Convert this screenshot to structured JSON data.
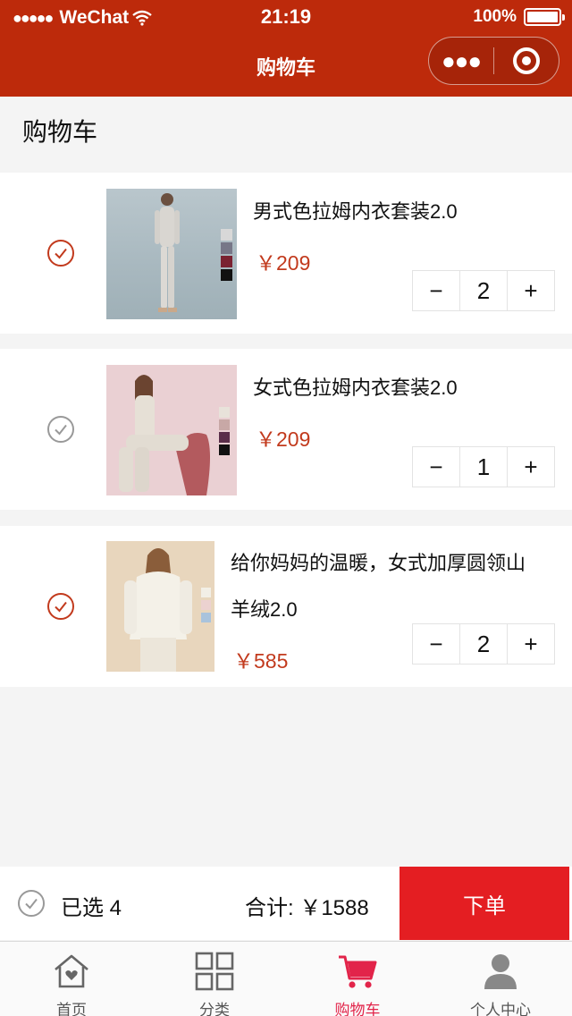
{
  "status_bar": {
    "signal": "●●●●●",
    "carrier": "WeChat",
    "time": "21:19",
    "battery_text": "100%"
  },
  "nav": {
    "title": "购物车",
    "more_icon": "●●●"
  },
  "page": {
    "heading": "购物车"
  },
  "colors": {
    "header": "#bd2a0b",
    "price": "#c23a1d",
    "order_button": "#e41e22",
    "tab_active": "#e2244a"
  },
  "cart": {
    "items": [
      {
        "title": "男式色拉姆内衣套装2.0",
        "price": "￥209",
        "quantity": "2",
        "checked": true,
        "minus": "−",
        "plus": "+"
      },
      {
        "title": "女式色拉姆内衣套装2.0",
        "price": "￥209",
        "quantity": "1",
        "checked": false,
        "minus": "−",
        "plus": "+"
      },
      {
        "title_line1": "给你妈妈的温暖，女式加厚圆领山",
        "title_line2": "羊绒2.0",
        "price": "￥585",
        "quantity": "2",
        "checked": true,
        "minus": "−",
        "plus": "+"
      }
    ]
  },
  "summary": {
    "selected_label": "已选 4",
    "total_label": "合计: ￥1588",
    "order_button": "下单"
  },
  "tabbar": {
    "items": [
      {
        "label": "首页",
        "icon": "home-icon"
      },
      {
        "label": "分类",
        "icon": "grid-icon"
      },
      {
        "label": "购物车",
        "icon": "cart-icon",
        "active": true
      },
      {
        "label": "个人中心",
        "icon": "user-icon"
      }
    ]
  }
}
